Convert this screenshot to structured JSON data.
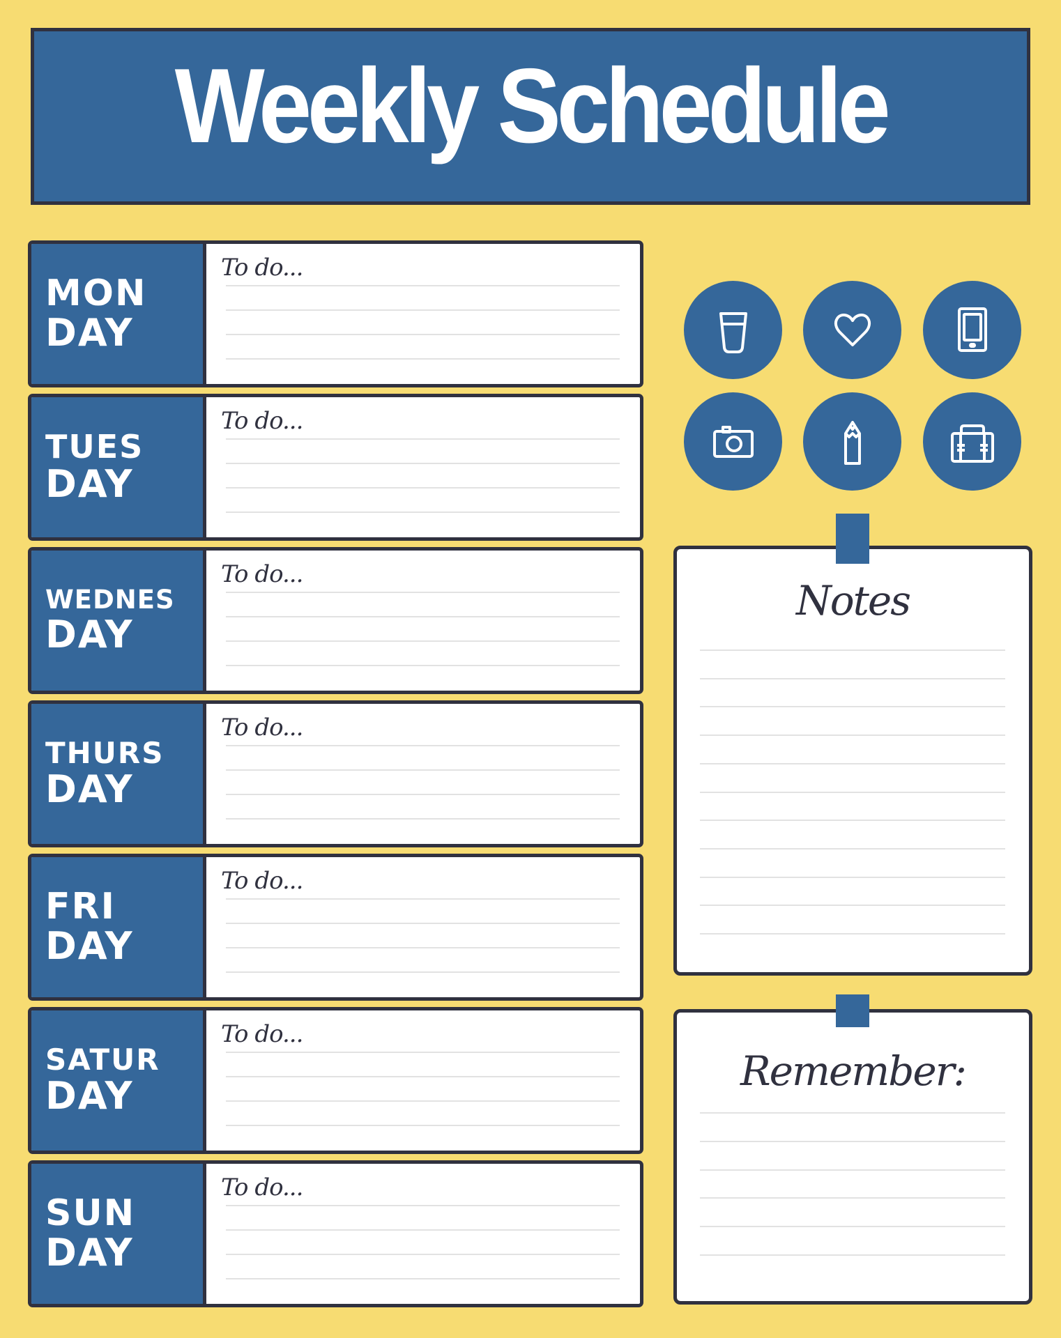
{
  "title": "Weekly Schedule",
  "colors": {
    "background": "#F7DC72",
    "primary_blue": "#35679A",
    "border_dark": "#30313F",
    "rule_gray": "#E2E2E2"
  },
  "days": [
    {
      "line1": "MON",
      "line2": "DAY",
      "todo_label": "To do..."
    },
    {
      "line1": "TUES",
      "line2": "DAY",
      "todo_label": "To do..."
    },
    {
      "line1": "WEDNES",
      "line2": "DAY",
      "todo_label": "To do..."
    },
    {
      "line1": "THURS",
      "line2": "DAY",
      "todo_label": "To do..."
    },
    {
      "line1": "FRI",
      "line2": "DAY",
      "todo_label": "To do..."
    },
    {
      "line1": "SATUR",
      "line2": "DAY",
      "todo_label": "To do..."
    },
    {
      "line1": "SUN",
      "line2": "DAY",
      "todo_label": "To do..."
    }
  ],
  "icons": [
    "cup-icon",
    "heart-icon",
    "tablet-icon",
    "camera-icon",
    "pencil-icon",
    "briefcase-icon"
  ],
  "notes": {
    "title": "Notes",
    "line_count": 11
  },
  "remember": {
    "title": "Remember:",
    "line_count": 6
  }
}
